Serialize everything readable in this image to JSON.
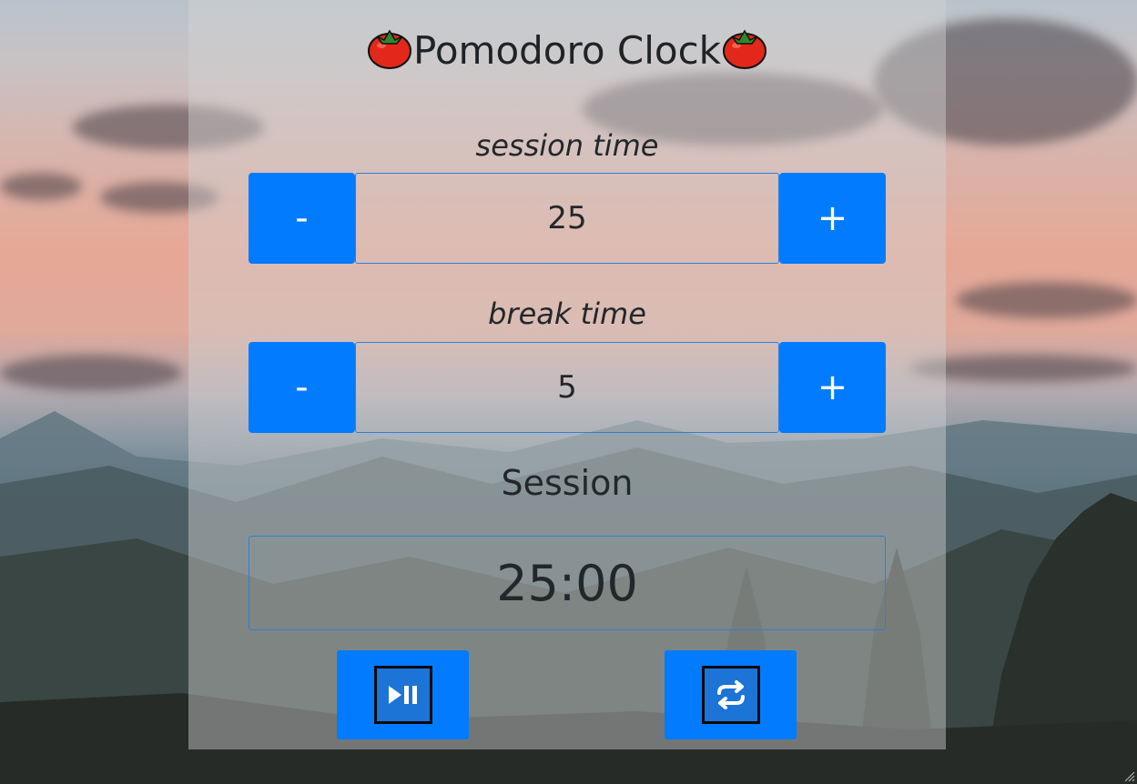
{
  "app": {
    "title": "Pomodoro Clock"
  },
  "session": {
    "label": "session time",
    "value": "25",
    "decrement_label": "-",
    "increment_label": "+"
  },
  "break": {
    "label": "break time",
    "value": "5",
    "decrement_label": "-",
    "increment_label": "+"
  },
  "timer": {
    "mode_label": "Session",
    "display": "25:00"
  },
  "controls": {
    "play_pause_icon": "play-pause-icon",
    "reset_icon": "repeat-icon"
  },
  "colors": {
    "accent": "#037bff",
    "border": "#2f7fd8",
    "text": "#23272b"
  }
}
